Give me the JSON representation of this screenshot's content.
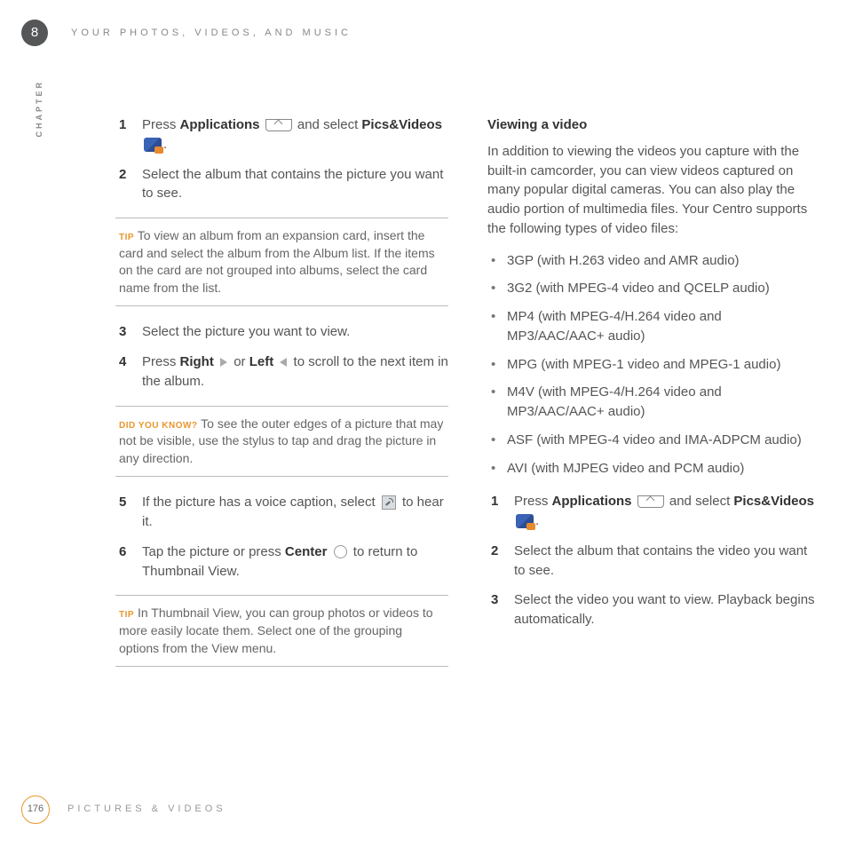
{
  "chapter": {
    "number": "8",
    "label": "CHAPTER"
  },
  "header": {
    "title": "YOUR PHOTOS, VIDEOS, AND MUSIC"
  },
  "left": {
    "step1": {
      "pre": "Press ",
      "bold1": "Applications",
      "mid": " and select ",
      "bold2": "Pics&Videos",
      "post": "."
    },
    "step2": "Select the album that contains the picture you want to see.",
    "tip1": {
      "label": "TIP",
      "text": " To view an album from an expansion card, insert the card and select the album from the Album list. If the items on the card are not grouped into albums, select the card name from the list."
    },
    "step3": "Select the picture you want to view.",
    "step4": {
      "pre": "Press ",
      "b1": "Right",
      "mid": " or ",
      "b2": "Left",
      "post": " to scroll to the next item in the album."
    },
    "dyk": {
      "label": "DID YOU KNOW?",
      "text": " To see the outer edges of a picture that may not be visible, use the stylus to tap and drag the picture in any direction."
    },
    "step5": {
      "pre": "If the picture has a voice caption, select ",
      "post": " to hear it."
    },
    "step6": {
      "pre": "Tap the picture or press ",
      "b": "Center",
      "post": " to return to Thumbnail View."
    },
    "tip2": {
      "label": "TIP",
      "text": " In Thumbnail View, you can group photos or videos to more easily locate them. Select one of the grouping options from the View menu."
    }
  },
  "right": {
    "heading": "Viewing a video",
    "intro": "In addition to viewing the videos you capture with the built-in camcorder, you can view videos captured on many popular digital cameras. You can also play the audio portion of multimedia files. Your Centro supports the following types of video files:",
    "formats": [
      "3GP (with H.263 video and AMR audio)",
      "3G2 (with MPEG-4 video and QCELP audio)",
      "MP4 (with MPEG-4/H.264 video and MP3/AAC/AAC+ audio)",
      "MPG (with MPEG-1 video and MPEG-1 audio)",
      "M4V (with MPEG-4/H.264 video and MP3/AAC/AAC+ audio)",
      "ASF (with MPEG-4 video and IMA-ADPCM audio)",
      "AVI (with MJPEG video and PCM audio)"
    ],
    "step1": {
      "pre": "Press ",
      "bold1": "Applications",
      "mid": " and select ",
      "bold2": "Pics&Videos",
      "post": "."
    },
    "step2": "Select the album that contains the video you want to see.",
    "step3": "Select the video you want to view. Playback begins automatically."
  },
  "footer": {
    "page": "176",
    "title": "PICTURES & VIDEOS"
  }
}
